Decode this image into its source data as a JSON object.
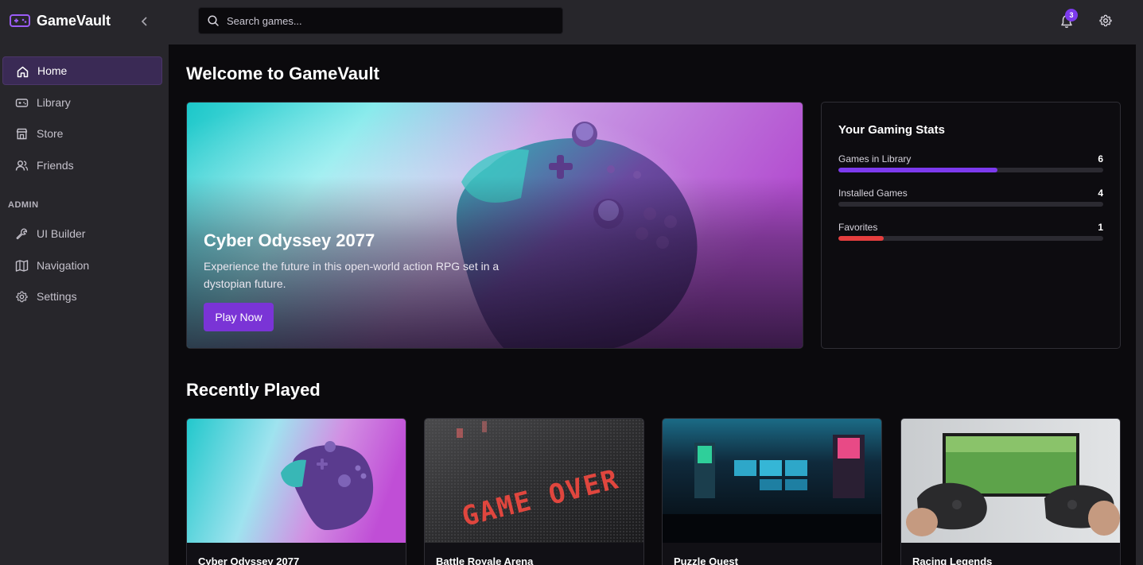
{
  "app": {
    "name": "GameVault",
    "accent": "#7c3aed"
  },
  "search": {
    "placeholder": "Search games..."
  },
  "header": {
    "notification_count": "3"
  },
  "sidebar": {
    "items": [
      {
        "label": "Home",
        "icon": "home-icon",
        "active": true
      },
      {
        "label": "Library",
        "icon": "gamepad-icon",
        "active": false
      },
      {
        "label": "Store",
        "icon": "store-icon",
        "active": false
      },
      {
        "label": "Friends",
        "icon": "users-icon",
        "active": false
      }
    ],
    "admin_label": "ADMIN",
    "admin_items": [
      {
        "label": "UI Builder",
        "icon": "wrench-icon"
      },
      {
        "label": "Navigation",
        "icon": "map-icon"
      },
      {
        "label": "Settings",
        "icon": "gear-icon"
      }
    ]
  },
  "main": {
    "title": "Welcome to GameVault",
    "hero": {
      "title": "Cyber Odyssey 2077",
      "description": "Experience the future in this open-world action RPG set in a dystopian future.",
      "button_label": "Play Now"
    },
    "stats": {
      "title": "Your Gaming Stats",
      "items": [
        {
          "label": "Games in Library",
          "value": "6",
          "fill": 0.6,
          "color": "#7c3aed"
        },
        {
          "label": "Installed Games",
          "value": "4",
          "fill": 0,
          "color": "#7c3aed"
        },
        {
          "label": "Favorites",
          "value": "1",
          "fill": 0.17,
          "color": "#e53e3e"
        }
      ]
    },
    "recent_title": "Recently Played",
    "recent": [
      {
        "title": "Cyber Odyssey 2077",
        "art": "controller"
      },
      {
        "title": "Battle Royale Arena",
        "art": "game-over"
      },
      {
        "title": "Puzzle Quest",
        "art": "arcade"
      },
      {
        "title": "Racing Legends",
        "art": "tv-controllers"
      }
    ]
  }
}
